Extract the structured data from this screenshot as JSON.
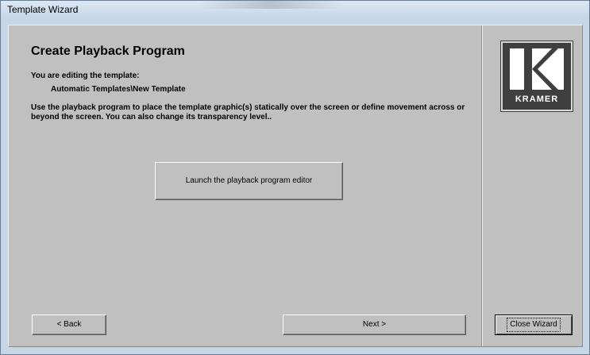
{
  "window": {
    "title": "Template Wizard"
  },
  "page": {
    "heading": "Create Playback Program",
    "editing_label": "You are editing the template:",
    "template_path": "Automatic Templates\\New Template",
    "description": "Use the playback program to place the template graphic(s) statically over the screen or define movement across or beyond the screen. You can also change its transparency level.."
  },
  "buttons": {
    "launch": "Launch the playback program editor",
    "back": "< Back",
    "next": "Next >",
    "close": "Close Wizard"
  },
  "logo": {
    "name": "kramer-logo",
    "text": "KRAMER",
    "background": "#3f3f3f",
    "foreground": "#ffffff"
  }
}
